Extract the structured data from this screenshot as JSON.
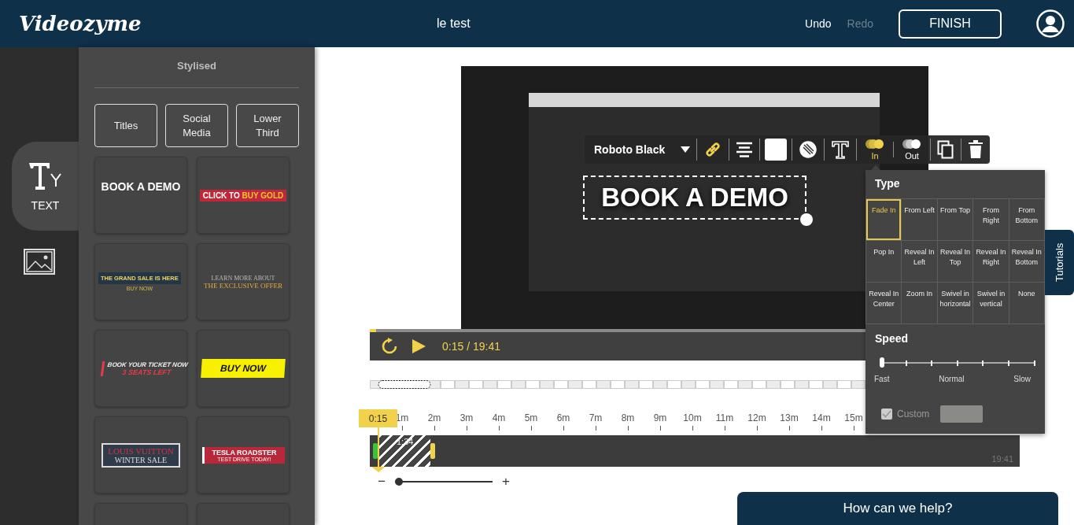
{
  "header": {
    "logo": "Videozyme",
    "project_title": "le test",
    "undo": {
      "label": "Undo",
      "disabled": false
    },
    "redo": {
      "label": "Redo",
      "disabled": true
    },
    "finish": "FINISH"
  },
  "rail": [
    {
      "kind": "text",
      "label": "TEXT",
      "selected": true
    },
    {
      "kind": "image",
      "selected": false
    }
  ],
  "library": {
    "heading": "Stylised",
    "categories": [
      "Titles",
      "Social Media",
      "Lower Third"
    ],
    "templates": [
      {
        "kind": "plain",
        "lines": [
          "BOOK A DEMO"
        ]
      },
      {
        "kind": "red-banner",
        "lines": [
          "CLICK TO",
          "BUY GOLD"
        ]
      },
      {
        "kind": "navy-banner",
        "lines": [
          "THE GRAND SALE IS HERE",
          "BUY NOW"
        ]
      },
      {
        "kind": "serif-offer",
        "lines": [
          "LEARN MORE ABOUT",
          "THE EXCLUSIVE OFFER"
        ]
      },
      {
        "kind": "slanted",
        "lines": [
          "BOOK YOUR TICKET NOW",
          "3 SEATS LEFT"
        ]
      },
      {
        "kind": "yellow-slant",
        "lines": [
          "BUY NOW"
        ]
      },
      {
        "kind": "framed",
        "lines": [
          "LOUIS VUITTON",
          "WINTER SALE"
        ]
      },
      {
        "kind": "red-bar",
        "lines": [
          "TESLA ROADSTER",
          "TEST DRIVE TODAY!"
        ]
      },
      {
        "kind": "empty"
      },
      {
        "kind": "empty"
      }
    ]
  },
  "editor": {
    "toolbar": {
      "font": "Roboto Black",
      "transitions": [
        {
          "label": "In",
          "selected": true
        },
        {
          "label": "Out",
          "selected": false
        }
      ]
    },
    "overlay_text": "BOOK A DEMO",
    "player": {
      "progress": {
        "level": 0.0127
      },
      "time": "0:15 / 19:41"
    },
    "timeline": {
      "playhead": "0:15",
      "ruler": [
        "1m",
        "2m",
        "3m",
        "4m",
        "5m",
        "6m",
        "7m",
        "8m",
        "9m",
        "10m",
        "11m",
        "12m",
        "13m",
        "14m",
        "15m"
      ],
      "clip": "1:34",
      "end_time": "19:41",
      "zoom": {
        "minus": "−",
        "plus": "+",
        "level": 0
      }
    }
  },
  "animation_panel": {
    "type_title": "Type",
    "types": [
      {
        "label": "Fade In",
        "selected": true
      },
      {
        "label": "From Left",
        "selected": false
      },
      {
        "label": "From Top",
        "selected": false
      },
      {
        "label": "From Right",
        "selected": false
      },
      {
        "label": "From Bottom",
        "selected": false
      },
      {
        "label": "Pop In",
        "selected": false
      },
      {
        "label": "Reveal In Left",
        "selected": false
      },
      {
        "label": "Reveal In Top",
        "selected": false
      },
      {
        "label": "Reveal In Right",
        "selected": false
      },
      {
        "label": "Reveal In Bottom",
        "selected": false
      },
      {
        "label": "Reveal In Center",
        "selected": false
      },
      {
        "label": "Zoom In",
        "selected": false
      },
      {
        "label": "Swivel in horizontal",
        "selected": false
      },
      {
        "label": "Swivel in vertical",
        "selected": false
      },
      {
        "label": "None",
        "selected": false
      }
    ],
    "speed_title": "Speed",
    "speed": {
      "level": 0,
      "labels": [
        "Fast",
        "Normal",
        "Slow"
      ]
    },
    "custom": {
      "label": "Custom",
      "checked": true,
      "disabled": true
    }
  },
  "tutorials": "Tutorials",
  "chat": "How can we help?"
}
